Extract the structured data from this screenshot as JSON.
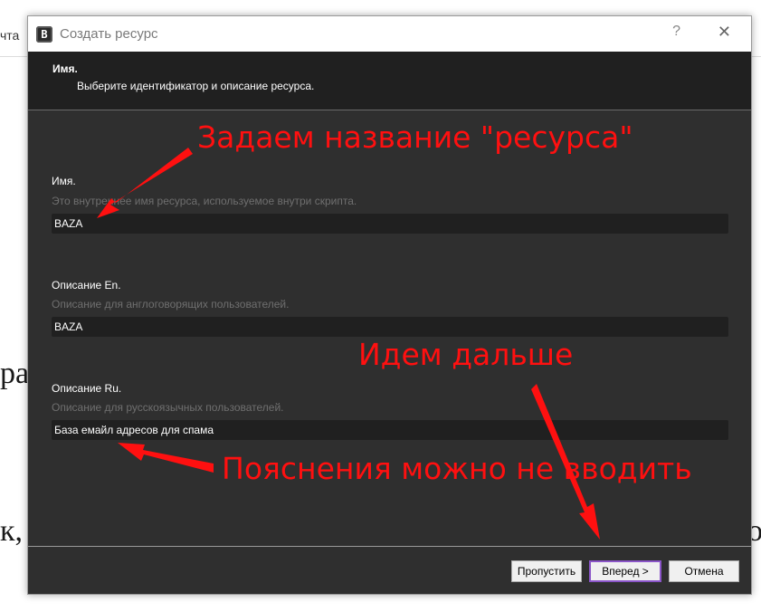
{
  "background": {
    "nav_fragment": "чта",
    "text_1": "ра",
    "text_2": "к,",
    "text_3": "о"
  },
  "dialog": {
    "title": "Создать ресурс",
    "help_label": "?",
    "close_label": "✕",
    "header": {
      "title": "Имя.",
      "subtitle": "Выберите идентификатор и описание ресурса."
    },
    "fields": [
      {
        "label": "Имя.",
        "hint": "Это внутреннее имя ресурса, используемое внутри скрипта.",
        "value": "BAZA"
      },
      {
        "label": "Описание En.",
        "hint": "Описание для англоговорящих пользователей.",
        "value": "BAZA"
      },
      {
        "label": "Описание Ru.",
        "hint": "Описание для русскоязычных пользователей.",
        "value": "База емайл адресов для спама"
      }
    ],
    "buttons": {
      "skip": "Пропустить",
      "next": "Вперед >",
      "cancel": "Отмена"
    }
  },
  "annotations": {
    "name_note": "Задаем название \"ресурса\"",
    "next_note": "Идем дальше",
    "desc_note": "Пояснения можно не вводить",
    "color": "#ff1010"
  },
  "icons": {
    "app": "app-logo-icon",
    "help": "help-icon",
    "close": "close-icon"
  }
}
